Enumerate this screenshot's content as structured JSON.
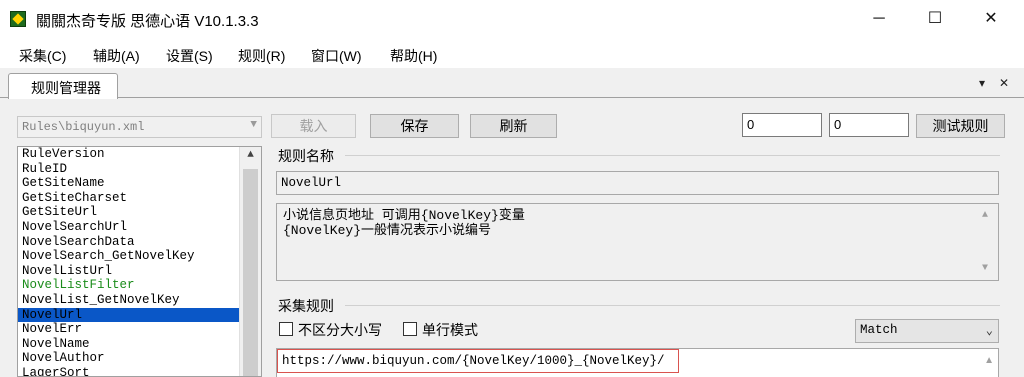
{
  "window": {
    "title": "關關杰奇专版 思德心语 V10.1.3.3",
    "minimize_glyph": "─",
    "maximize_glyph": "☐",
    "close_glyph": "✕"
  },
  "menu": [
    "采集(C)",
    "辅助(A)",
    "设置(S)",
    "规则(R)",
    "窗口(W)",
    "帮助(H)"
  ],
  "tab": {
    "label": "规则管理器",
    "dropdown_glyph": "▾",
    "close_glyph": "✕"
  },
  "left_panel": {
    "rule_file": "Rules\\biquyun.xml",
    "items": [
      {
        "label": "RuleVersion",
        "state": "normal"
      },
      {
        "label": "RuleID",
        "state": "normal"
      },
      {
        "label": "GetSiteName",
        "state": "normal"
      },
      {
        "label": "GetSiteCharset",
        "state": "normal"
      },
      {
        "label": "GetSiteUrl",
        "state": "normal"
      },
      {
        "label": "NovelSearchUrl",
        "state": "normal"
      },
      {
        "label": "NovelSearchData",
        "state": "normal"
      },
      {
        "label": "NovelSearch_GetNovelKey",
        "state": "normal"
      },
      {
        "label": "NovelListUrl",
        "state": "normal"
      },
      {
        "label": "NovelListFilter",
        "state": "green"
      },
      {
        "label": "NovelList_GetNovelKey",
        "state": "normal"
      },
      {
        "label": "NovelUrl",
        "state": "selected"
      },
      {
        "label": "NovelErr",
        "state": "normal"
      },
      {
        "label": "NovelName",
        "state": "normal"
      },
      {
        "label": "NovelAuthor",
        "state": "normal"
      },
      {
        "label": "LagerSort",
        "state": "normal"
      }
    ]
  },
  "toolbar": {
    "load_label": "载入",
    "save_label": "保存",
    "refresh_label": "刷新",
    "input1_value": "0",
    "input2_value": "0",
    "test_label": "测试规则"
  },
  "rule_name": {
    "heading": "规则名称",
    "value": "NovelUrl"
  },
  "description": {
    "line1": "小说信息页地址 可调用{NovelKey}变量",
    "line2": "{NovelKey}一般情况表示小说编号"
  },
  "collect_rule": {
    "heading": "采集规则",
    "case_insensitive_label": "不区分大小写",
    "single_line_label": "单行模式",
    "mode_value": "Match",
    "pattern": "https://www.biquyun.com/{NovelKey/1000}_{NovelKey}/"
  },
  "colors": {
    "selection": "#0a57c7",
    "green_item": "#1a8c1a",
    "highlight_border": "#d9534f"
  }
}
